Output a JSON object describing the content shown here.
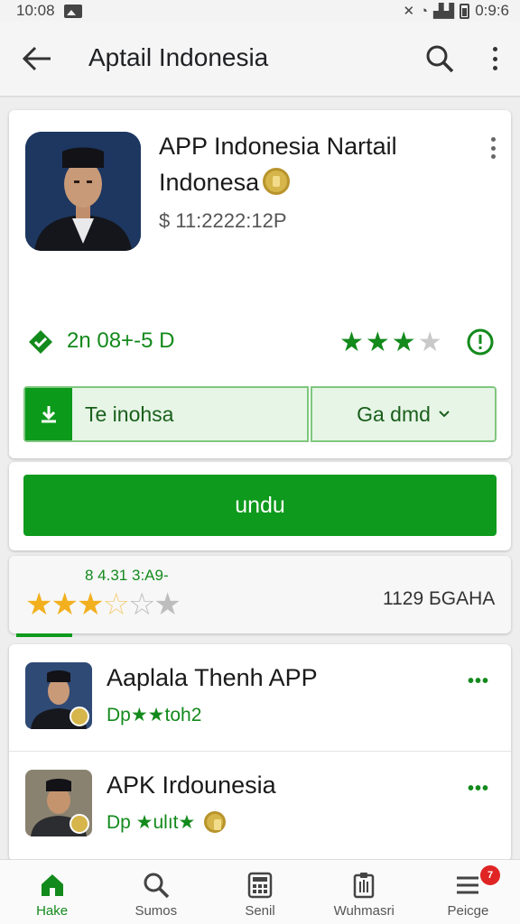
{
  "status_bar": {
    "time": "10:08",
    "right_text": "0:9:6"
  },
  "app_bar": {
    "title": "Aptail Indonesia"
  },
  "app": {
    "name": "APP Indonesia Nartail Indonesa",
    "price": "$ 11:2222:12P",
    "meta_count": "2n 08+-5 D",
    "install_label": "Te inohsa",
    "secondary_label": "Ga dmd",
    "download_label": "undu",
    "stars_green": 3.5
  },
  "rating": {
    "subtext": "8 4.31 3:A9-",
    "stars": 3.5,
    "total": "1129 БGAHA"
  },
  "list": [
    {
      "title": "Aaplala Thenh APP",
      "subtitle": "Dp★★toh2"
    },
    {
      "title": "APK Irdounesia",
      "subtitle": "Dp ★ulıt★"
    }
  ],
  "nav": [
    {
      "label": "Hake",
      "icon": "home-icon",
      "active": true
    },
    {
      "label": "Sumos",
      "icon": "search-icon",
      "active": false
    },
    {
      "label": "Senil",
      "icon": "calculator-icon",
      "active": false
    },
    {
      "label": "Wuhmasri",
      "icon": "clipboard-icon",
      "active": false
    },
    {
      "label": "Peicge",
      "icon": "menu-icon",
      "active": false,
      "badge": "7"
    }
  ],
  "colors": {
    "accent": "#0e9a1c",
    "star": "#f2b01e",
    "badge": "#e02424"
  }
}
